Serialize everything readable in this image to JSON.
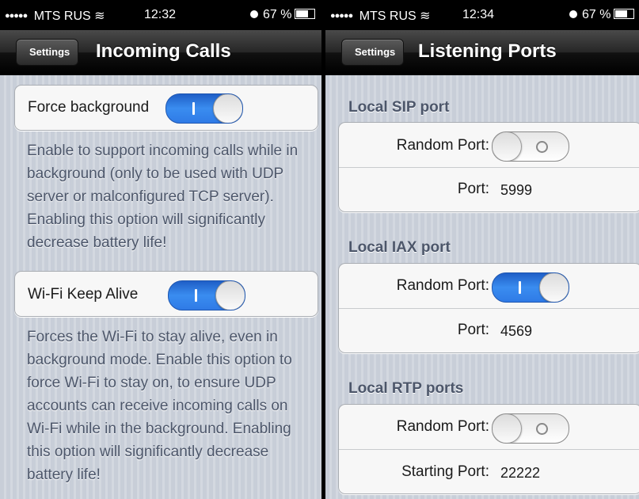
{
  "screen1": {
    "status": {
      "carrier": "MTS RUS",
      "time": "12:32",
      "battery": "67 %"
    },
    "nav": {
      "back_label": "Settings",
      "title": "Incoming Calls"
    },
    "force_background": {
      "label": "Force background",
      "on": true,
      "description": "Enable to support incoming calls while in background (only to be used with UDP server or malconfigured TCP server). Enabling this option will significantly decrease battery life!"
    },
    "wifi_keep_alive": {
      "label": "Wi-Fi Keep Alive",
      "on": true,
      "description": "Forces the Wi-Fi to stay alive, even in background mode. Enable this option to force Wi-Fi to stay on, to ensure UDP accounts can receive incoming calls on Wi-Fi while in the background. Enabling this option will significantly decrease battery life!"
    }
  },
  "screen2": {
    "status": {
      "carrier": "MTS RUS",
      "time": "12:34",
      "battery": "67 %"
    },
    "nav": {
      "back_label": "Settings",
      "title": "Listening Ports"
    },
    "sip": {
      "header": "Local SIP port",
      "random_label": "Random Port:",
      "random_on": false,
      "port_label": "Port:",
      "port_value": "5999"
    },
    "iax": {
      "header": "Local IAX port",
      "random_label": "Random Port:",
      "random_on": true,
      "port_label": "Port:",
      "port_value": "4569"
    },
    "rtp": {
      "header": "Local RTP ports",
      "random_label": "Random Port:",
      "random_on": false,
      "port_label": "Starting Port:",
      "port_value": "22222"
    }
  },
  "colors": {
    "toggle_on": "#2f7ae6",
    "nav_bar": "#1a1a1a",
    "section_text": "#4c566a"
  },
  "icons": [
    "signal-dots-icon",
    "wifi-icon",
    "alarm-icon",
    "battery-icon",
    "back-chevron-icon"
  ]
}
